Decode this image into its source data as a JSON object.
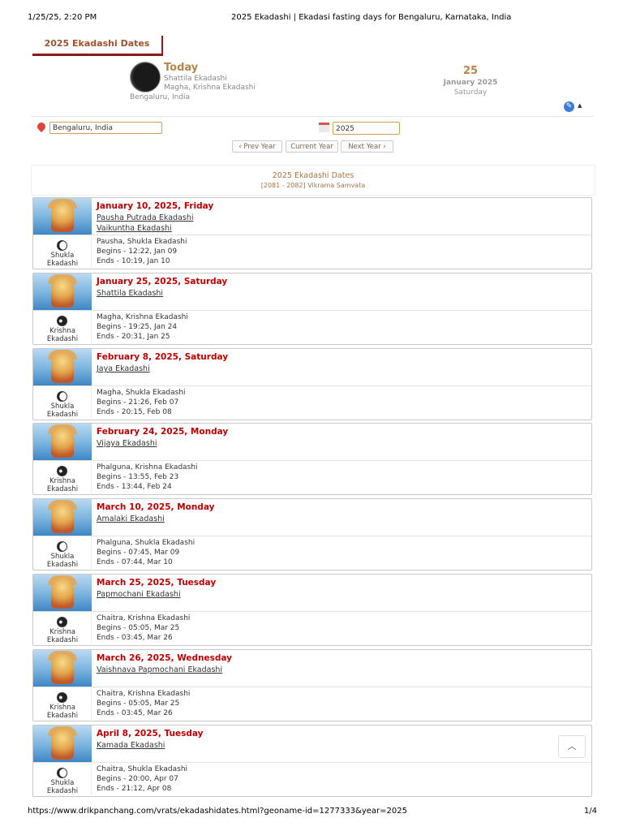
{
  "print_header": {
    "datetime": "1/25/25, 2:20 PM",
    "title": "2025 Ekadashi | Ekadasi fasting days for Bengaluru, Karnataka, India"
  },
  "print_footer": {
    "url": "https://www.drikpanchang.com/vrats/ekadashidates.html?geoname-id=1277333&year=2025",
    "page": "1/4"
  },
  "page_tab": "2025 Ekadashi Dates",
  "today": {
    "label": "Today",
    "ekadashi": "Shattila Ekadashi",
    "paksha": "Magha, Krishna Ekadashi",
    "location": "Bengaluru, India",
    "day": "25",
    "month_year": "January 2025",
    "weekday": "Saturday"
  },
  "controls": {
    "location_value": "Bengaluru, India",
    "year_value": "2025",
    "prev_label": "‹ Prev Year",
    "current_label": "Current Year",
    "next_label": "Next Year ›"
  },
  "section": {
    "title": "2025 Ekadashi Dates",
    "subtitle": "[2081 - 2082] Vikrama Samvata"
  },
  "entries": [
    {
      "date": "January 10, 2025, Friday",
      "names": [
        "Pausha Putrada Ekadashi",
        "Vaikuntha Ekadashi"
      ],
      "paksha_type": "Shukla",
      "paksha_word": "Ekadashi",
      "tithi": "Pausha, Shukla Ekadashi",
      "begins": "Begins - 12:22, Jan 09",
      "ends": "Ends - 10:19, Jan 10"
    },
    {
      "date": "January 25, 2025, Saturday",
      "names": [
        "Shattila Ekadashi"
      ],
      "paksha_type": "Krishna",
      "paksha_word": "Ekadashi",
      "tithi": "Magha, Krishna Ekadashi",
      "begins": "Begins - 19:25, Jan 24",
      "ends": "Ends - 20:31, Jan 25"
    },
    {
      "date": "February 8, 2025, Saturday",
      "names": [
        "Jaya Ekadashi"
      ],
      "paksha_type": "Shukla",
      "paksha_word": "Ekadashi",
      "tithi": "Magha, Shukla Ekadashi",
      "begins": "Begins - 21:26, Feb 07",
      "ends": "Ends - 20:15, Feb 08"
    },
    {
      "date": "February 24, 2025, Monday",
      "names": [
        "Vijaya Ekadashi"
      ],
      "paksha_type": "Krishna",
      "paksha_word": "Ekadashi",
      "tithi": "Phalguna, Krishna Ekadashi",
      "begins": "Begins - 13:55, Feb 23",
      "ends": "Ends - 13:44, Feb 24"
    },
    {
      "date": "March 10, 2025, Monday",
      "names": [
        "Amalaki Ekadashi"
      ],
      "paksha_type": "Shukla",
      "paksha_word": "Ekadashi",
      "tithi": "Phalguna, Shukla Ekadashi",
      "begins": "Begins - 07:45, Mar 09",
      "ends": "Ends - 07:44, Mar 10"
    },
    {
      "date": "March 25, 2025, Tuesday",
      "names": [
        "Papmochani Ekadashi"
      ],
      "paksha_type": "Krishna",
      "paksha_word": "Ekadashi",
      "tithi": "Chaitra, Krishna Ekadashi",
      "begins": "Begins - 05:05, Mar 25",
      "ends": "Ends - 03:45, Mar 26"
    },
    {
      "date": "March 26, 2025, Wednesday",
      "names": [
        "Vaishnava Papmochani Ekadashi"
      ],
      "paksha_type": "Krishna",
      "paksha_word": "Ekadashi",
      "tithi": "Chaitra, Krishna Ekadashi",
      "begins": "Begins - 05:05, Mar 25",
      "ends": "Ends - 03:45, Mar 26"
    },
    {
      "date": "April 8, 2025, Tuesday",
      "names": [
        "Kamada Ekadashi"
      ],
      "paksha_type": "Shukla",
      "paksha_word": "Ekadashi",
      "tithi": "Chaitra, Shukla Ekadashi",
      "begins": "Begins - 20:00, Apr 07",
      "ends": "Ends - 21:12, Apr 08"
    }
  ],
  "scroll_top_glyph": "︿"
}
